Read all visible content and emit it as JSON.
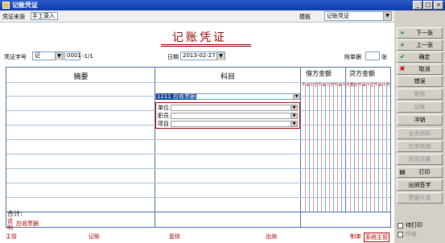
{
  "window": {
    "title": "记账凭证"
  },
  "strip": {
    "source_label": "凭证来源",
    "source_value": "手工录入",
    "template_label": "模板",
    "template_value": "记账凭证"
  },
  "voucher": {
    "title": "记账凭证",
    "type_label": "凭证字号",
    "type_value": "记",
    "number": "0001",
    "page": "-1/1",
    "date_label": "日期",
    "date_value": "2013-02-27",
    "attach_label": "附单据",
    "attach_unit": "张"
  },
  "table": {
    "col_summary": "摘要",
    "col_account": "科目",
    "col_debit": "借方金额",
    "col_credit": "贷方金额",
    "units": "千百十亿千百十万千百十元角分",
    "account_input": "1211 应收票据",
    "aux_fields": [
      {
        "label": "单位"
      },
      {
        "label": "职员"
      },
      {
        "label": "项目"
      }
    ],
    "total_label": "合计:"
  },
  "memo": {
    "label": "说明",
    "value": "应收票据"
  },
  "signatures": {
    "supervisor": "主管",
    "bookkeeping": "记账",
    "review": "复核",
    "cashier": "出纳",
    "maker_label": "制单",
    "maker_value": "系统主管"
  },
  "toolbar": {
    "buttons": [
      {
        "label": "下一张",
        "icon": "»",
        "disabled": false
      },
      {
        "label": "上一张",
        "icon": "«",
        "disabled": false
      },
      {
        "label": "确定",
        "icon": "✔",
        "disabled": false
      },
      {
        "label": "取消",
        "icon": "✖",
        "disabled": false
      },
      {
        "label": "错误",
        "icon": "",
        "disabled": false
      },
      {
        "label": "复核",
        "icon": "",
        "disabled": true
      },
      {
        "label": "记账",
        "icon": "",
        "disabled": true
      },
      {
        "label": "冲销",
        "icon": "",
        "disabled": false
      },
      {
        "label": "业务资料",
        "icon": "",
        "disabled": true
      },
      {
        "label": "往来核销",
        "icon": "",
        "disabled": true
      },
      {
        "label": "现金流量",
        "icon": "",
        "disabled": true
      },
      {
        "label": "打印",
        "icon": "▤",
        "disabled": false
      },
      {
        "label": "出纳签字",
        "icon": "",
        "disabled": false
      },
      {
        "label": "票据开具",
        "icon": "",
        "disabled": true
      }
    ],
    "print_pending": "待打印",
    "voided": "作废"
  },
  "colors": {
    "accent": "#8b0000",
    "title_bar": "#0d3aa8",
    "toolbar_bg": "#d4d0c8"
  }
}
